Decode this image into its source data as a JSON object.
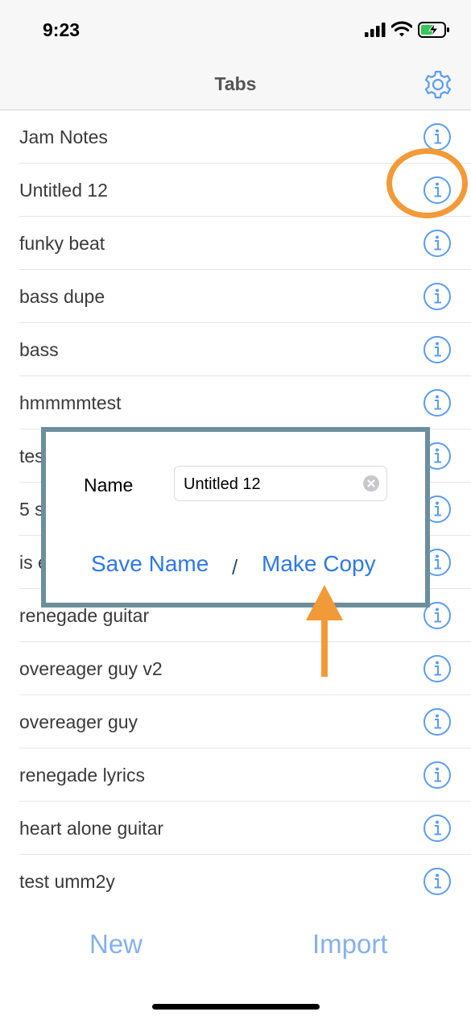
{
  "status": {
    "time": "9:23"
  },
  "nav": {
    "title": "Tabs"
  },
  "tabs": [
    {
      "label": "Jam Notes"
    },
    {
      "label": "Untitled 12"
    },
    {
      "label": "funky beat"
    },
    {
      "label": "bass dupe"
    },
    {
      "label": "bass"
    },
    {
      "label": "hmmmmtest"
    },
    {
      "label": "tes"
    },
    {
      "label": "5 s"
    },
    {
      "label": "is e"
    },
    {
      "label": "renegade guitar"
    },
    {
      "label": "overeager guy v2"
    },
    {
      "label": "overeager guy"
    },
    {
      "label": "renegade lyrics"
    },
    {
      "label": "heart alone guitar"
    },
    {
      "label": "test umm2y"
    }
  ],
  "popup": {
    "name_label": "Name",
    "name_value": "Untitled 12",
    "save_label": "Save Name",
    "separator": "/",
    "copy_label": "Make Copy"
  },
  "bottom": {
    "new_label": "New",
    "import_label": "Import"
  },
  "colors": {
    "accent": "#2f77e9",
    "info_icon": "#5b9cf0",
    "bottom_buttons": "#85b0ef",
    "highlight": "#f29a38",
    "popup_border": "#6d8e9c"
  },
  "icons": [
    "gear-icon",
    "info-icon",
    "clear-icon",
    "signal-icon",
    "wifi-icon",
    "battery-icon",
    "arrow-up-icon"
  ]
}
